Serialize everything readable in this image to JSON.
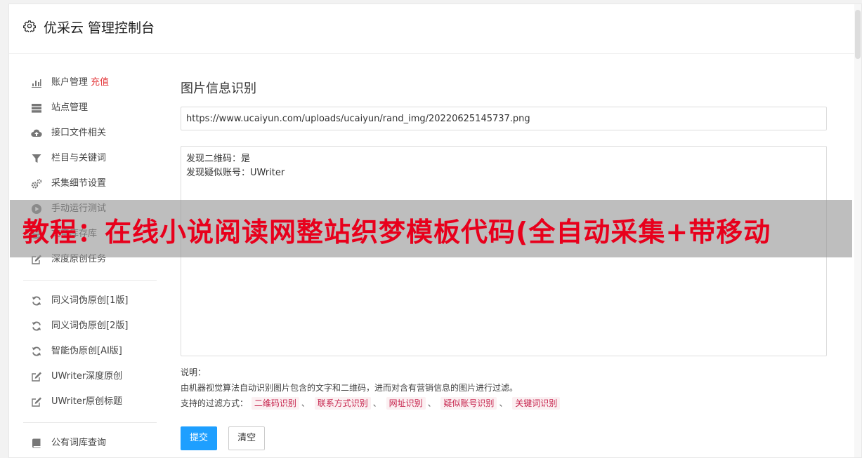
{
  "header": {
    "title": "优采云 管理控制台",
    "icon": "gear-icon"
  },
  "sidebar": {
    "group1": [
      {
        "label": "账户管理",
        "badge": "充值",
        "icon": "bar-chart-icon"
      },
      {
        "label": "站点管理",
        "icon": "server-icon"
      },
      {
        "label": "接口文件相关",
        "icon": "cloud-upload-icon"
      },
      {
        "label": "栏目与关键词",
        "icon": "filter-icon"
      },
      {
        "label": "采集细节设置",
        "icon": "gears-icon"
      },
      {
        "label": "手动运行测试",
        "icon": "play-icon"
      },
      {
        "label": "文章库存库",
        "icon": "database-icon"
      },
      {
        "label": "深度原创任务",
        "icon": "edit-icon"
      }
    ],
    "group2": [
      {
        "label": "同义词伪原创[1版]",
        "icon": "refresh-icon"
      },
      {
        "label": "同义词伪原创[2版]",
        "icon": "refresh-icon"
      },
      {
        "label": "智能伪原创[AI版]",
        "icon": "refresh-icon"
      },
      {
        "label": "UWriter深度原创",
        "icon": "edit-icon"
      },
      {
        "label": "UWriter原创标题",
        "icon": "edit-icon"
      }
    ],
    "group3": [
      {
        "label": "公有词库查询",
        "icon": "book-icon"
      }
    ]
  },
  "main": {
    "title": "图片信息识别",
    "url_value": "https://www.ucaiyun.com/uploads/ucaiyun/rand_img/20220625145737.png",
    "result_lines": [
      "发现二维码：是",
      "发现疑似账号：UWriter"
    ],
    "notes_label": "说明：",
    "notes_text": "由机器视觉算法自动识别图片包含的文字和二维码，进而对含有营销信息的图片进行过滤。",
    "filter_label": "支持的过滤方式：",
    "filter_tags": [
      "二维码识别",
      "联系方式识别",
      "网址识别",
      "疑似账号识别",
      "关键词识别"
    ],
    "tag_separator": "、",
    "submit_label": "提交",
    "clear_label": "清空"
  },
  "overlay": {
    "text": "教程：在线小说阅读网整站织梦模板代码(全自动采集+带移动"
  },
  "colors": {
    "accent": "#1e9fff",
    "badge": "#e4393c",
    "overlay_text": "#e8001c",
    "tag_text": "#c7254e"
  }
}
